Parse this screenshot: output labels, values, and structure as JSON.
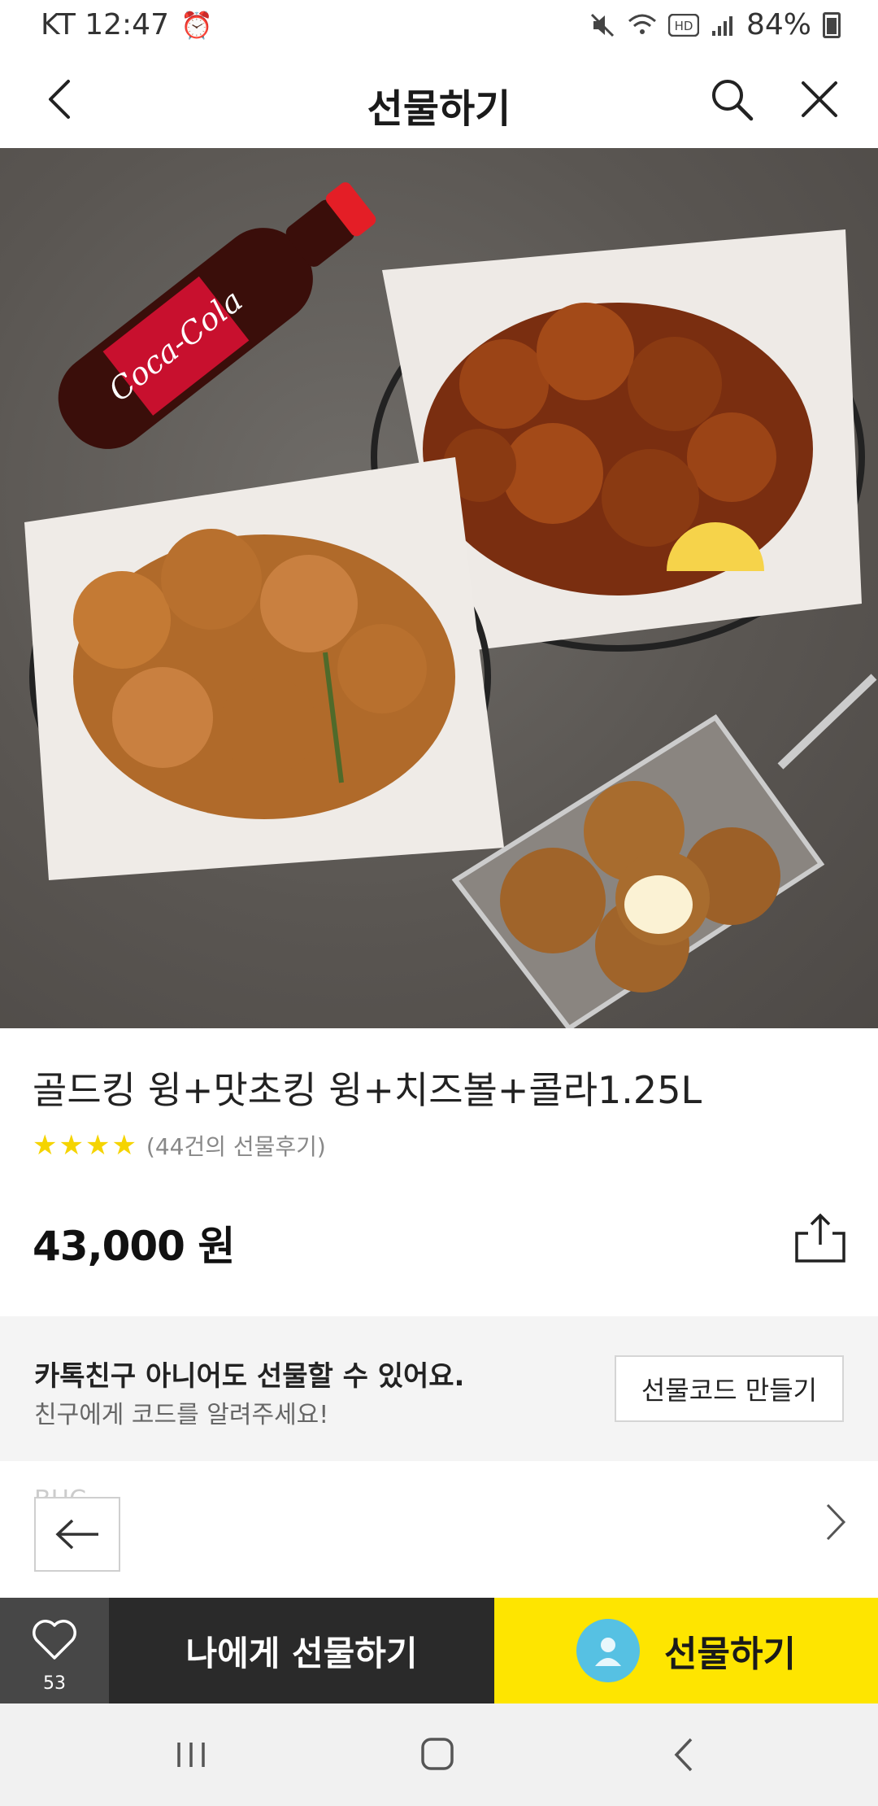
{
  "status_bar": {
    "carrier_time": "KT 12:47",
    "battery": "84%",
    "icons": [
      "alarm-icon",
      "mute-icon",
      "wifi-icon",
      "hd-icon",
      "signal-icon",
      "battery-icon"
    ]
  },
  "header": {
    "title": "선물하기",
    "icons": [
      "back-icon",
      "search-icon",
      "close-icon"
    ]
  },
  "hero_image": {
    "description_icons": [
      "cola-bottle",
      "fried-chicken",
      "seasoned-chicken",
      "cheese-balls"
    ]
  },
  "product": {
    "title": "골드킹 윙+맛초킹 윙+치즈볼+콜라1.25L",
    "stars": "★★★★",
    "review_count": "(44건의 선물후기)",
    "price": "43,000 원"
  },
  "promo": {
    "line1": "카톡친구 아니어도 선물할 수 있어요.",
    "line2": "친구에게 코드를 알려주세요!",
    "button_label": "선물코드 만들기"
  },
  "brand": {
    "label": "BHC"
  },
  "actions": {
    "like_count": "53",
    "gift_self_label": "나에게 선물하기",
    "gift_label": "선물하기"
  },
  "colors": {
    "accent_yellow": "#fee500",
    "dark_button": "#2a2a2a",
    "like_button": "#474747",
    "star": "#f5d400"
  }
}
